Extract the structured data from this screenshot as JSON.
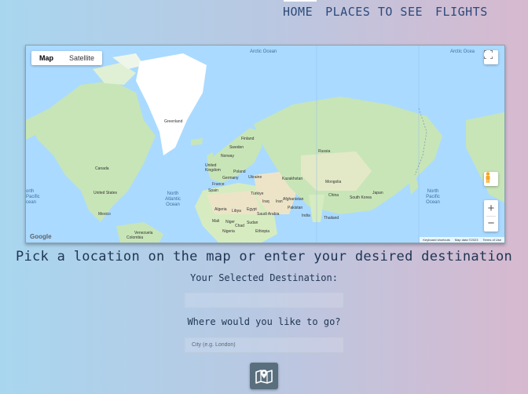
{
  "nav": {
    "home": "HOME",
    "places": "PLACES TO SEE",
    "flights": "FLIGHTS"
  },
  "map": {
    "map_type": {
      "map": "Map",
      "satellite": "Satellite"
    },
    "zoom_in": "+",
    "zoom_out": "−",
    "google_logo": "Google",
    "attribution": {
      "shortcuts": "Keyboard shortcuts",
      "data": "Map data ©2023",
      "terms": "Terms of Use"
    },
    "oceans": {
      "arctic_left": "Arctic Ocean",
      "arctic_right": "Arctic Ocea",
      "north_atlantic": "North Atlantic Ocean",
      "north_pacific_left": "orth Pacific cean",
      "north_pacific_right": "North Pacific Ocean"
    },
    "places": {
      "greenland": "Greenland",
      "canada": "Canada",
      "united_states": "United States",
      "mexico": "Mexico",
      "venezuela": "Venezuela",
      "colombia": "Colombia",
      "finland": "Finland",
      "sweden": "Sweden",
      "norway": "Norway",
      "united_kingdom": "United Kingdom",
      "poland": "Poland",
      "germany": "Germany",
      "ukraine": "Ukraine",
      "france": "France",
      "spain": "Spain",
      "turkiye": "Türkiye",
      "algeria": "Algeria",
      "libya": "Libya",
      "egypt": "Egypt",
      "mali": "Mali",
      "niger": "Niger",
      "chad": "Chad",
      "sudan": "Sudan",
      "nigeria": "Nigeria",
      "ethiopia": "Ethiopia",
      "saudi_arabia": "Saudi Arabia",
      "iran": "Iran",
      "iraq": "Iraq",
      "afghanistan": "Afghanistan",
      "pakistan": "Pakistan",
      "india": "India",
      "kazakhstan": "Kazakhstan",
      "russia": "Russia",
      "mongolia": "Mongolia",
      "china": "China",
      "south_korea": "South Korea",
      "japan": "Japan",
      "thailand": "Thailand"
    }
  },
  "main": {
    "heading": "Pick a location on the map or enter your desired destination",
    "selected_label": "Your Selected Destination:",
    "selected_value": "",
    "where_label": "Where would you like to go?",
    "city_placeholder": "City (e.g. London)"
  },
  "colors": {
    "water": "#aadaff",
    "land": "#c8e5b8",
    "ice": "#ffffff",
    "button": "#5a6f7e"
  }
}
